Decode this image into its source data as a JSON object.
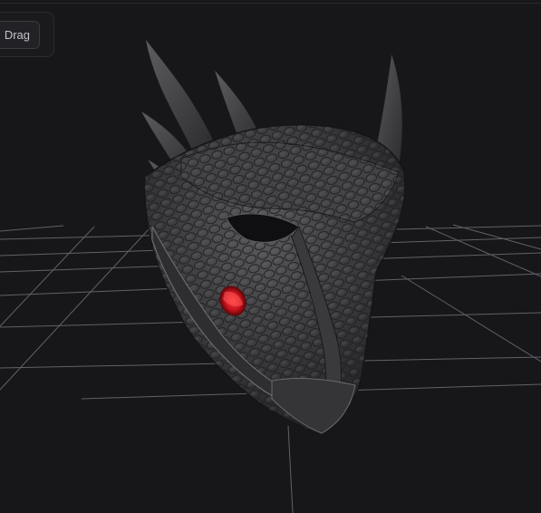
{
  "toolbar": {
    "drag_label": "Drag"
  },
  "viewport": {
    "background_color": "#17171a",
    "grid_color": "#7a7a80",
    "model": "dragon-mask",
    "model_color": "#3c3c3e",
    "eye_color": "#c8141e"
  }
}
